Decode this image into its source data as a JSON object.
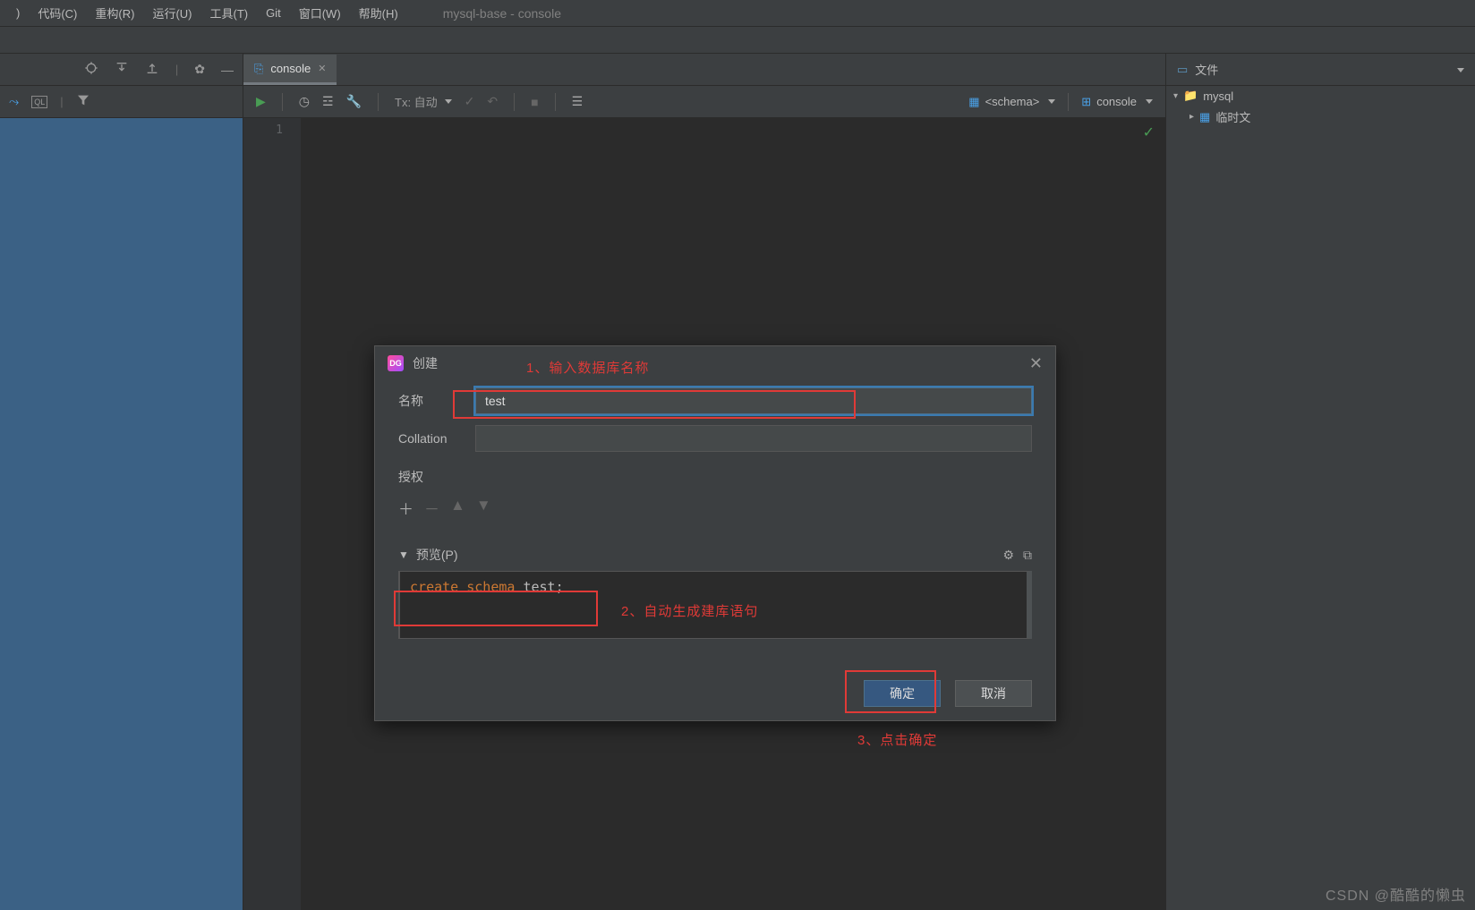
{
  "menu": {
    "code": "代码(C)",
    "refactor": "重构(R)",
    "run": "运行(U)",
    "tools": "工具(T)",
    "git": "Git",
    "window": "窗口(W)",
    "help": "帮助(H)",
    "window_title": "mysql-base - console"
  },
  "tabs": {
    "console": "console"
  },
  "editor_toolbar": {
    "tx_mode": "Tx: 自动",
    "schema_label": "<schema>",
    "console_label": "console"
  },
  "gutter": {
    "line1": "1"
  },
  "right_panel": {
    "files_label": "文件",
    "tree_root": "mysql",
    "tree_temp": "临时文"
  },
  "dialog": {
    "title": "创建",
    "name_label": "名称",
    "name_value": "test",
    "collation_label": "Collation",
    "collation_value": "",
    "grants_label": "授权",
    "preview_label": "预览(P)",
    "preview_sql_kw1": "create",
    "preview_sql_kw2": "schema",
    "preview_sql_id": "test;",
    "ok_label": "确定",
    "cancel_label": "取消"
  },
  "annotations": {
    "a1": "1、输入数据库名称",
    "a2": "2、自动生成建库语句",
    "a3": "3、点击确定"
  },
  "watermark": "CSDN @酷酷的懒虫"
}
